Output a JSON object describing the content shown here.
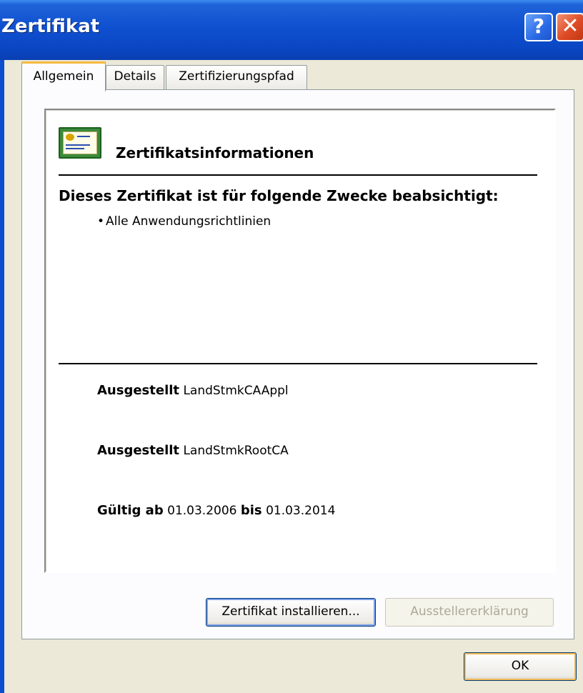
{
  "window": {
    "title": "Zertifikat",
    "help_label": "?",
    "close_label": "✕"
  },
  "tabs": [
    {
      "label": "Allgemein",
      "active": true
    },
    {
      "label": "Details",
      "active": false
    },
    {
      "label": "Zertifizierungspfad",
      "active": false
    }
  ],
  "info": {
    "title": "Zertifikatsinformationen",
    "purpose_heading": "Dieses Zertifikat ist für folgende Zwecke beabsichtigt:",
    "purpose_bullet": "•",
    "purposes": [
      "Alle Anwendungsrichtlinien"
    ],
    "issued_to_label": "Ausgestellt",
    "issued_to_value": "LandStmkCAAppl",
    "issued_by_label": "Ausgestellt",
    "issued_by_value": "LandStmkRootCA",
    "valid_from_label": "Gültig ab",
    "valid_from_value": "01.03.2006",
    "valid_to_label": "bis",
    "valid_to_value": "01.03.2014"
  },
  "buttons": {
    "install": "Zertifikat installieren...",
    "issuer_statement": "Ausstellererklärung",
    "ok": "OK"
  }
}
